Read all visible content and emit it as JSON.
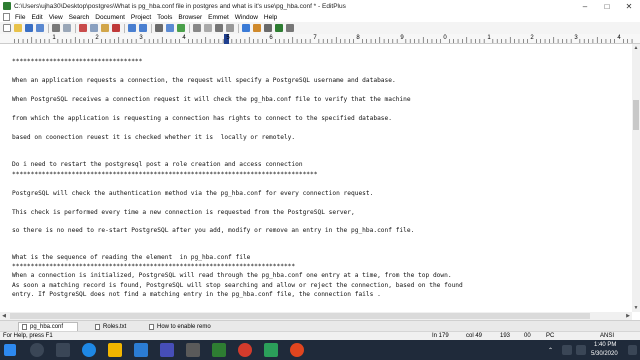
{
  "window": {
    "title": "C:\\Users\\ujha30\\Desktop\\postgres\\What is pg_hba.conf file in postgres and what is it's use\\pg_hba.conf * - EditPlus"
  },
  "menu": [
    "File",
    "Edit",
    "View",
    "Search",
    "Document",
    "Project",
    "Tools",
    "Browser",
    "Emmet",
    "Window",
    "Help"
  ],
  "ruler": [
    "1",
    "2",
    "3",
    "4",
    "5",
    "6",
    "7",
    "8",
    "9",
    "0",
    "1",
    "2",
    "3",
    "4"
  ],
  "editor": {
    "lines": [
      "***********************************",
      "",
      "When an application requests a connection, the request will specify a PostgreSQL username and database.",
      "",
      "When PostgreSQL receives a connection request it will check the pg_hba.conf file to verify that the machine",
      "",
      "from which the application is requesting a connection has rights to connect to the specified database.",
      "",
      "based on coonection reuest it is checked whether it is  locally or remotely.",
      "",
      "",
      "Do i need to restart the postgresql post a role creation and access connection",
      "**********************************************************************************",
      "",
      "PostgreSQL will check the authentication method via the pg_hba.conf for every connection request.",
      "",
      "This check is performed every time a new connection is requested from the PostgreSQL server,",
      "",
      "",
      "so there is no need to re-start PostgreSQL after you add, modify or remove an entry in the pg_hba.conf file.",
      "",
      "",
      "What is the sequence of reading the element  in pg_hba.conf file",
      "****************************************************************************",
      "When a connection is initialized, PostgreSQL will read through the pg_hba.conf one entry at a time, from the top down.",
      "As soon a matching record is found, PostgreSQL will stop searching and allow or reject the connection, based on the found",
      "entry. If PostgreSQL does not find a matching entry in the pg_hba.conf file, the connection fails ."
    ]
  },
  "tabs": [
    {
      "label": "pg_hba.conf",
      "active": true
    },
    {
      "label": "Roles.txt",
      "active": false
    },
    {
      "label": "How to enable remo",
      "active": false
    }
  ],
  "status": {
    "help": "For Help, press F1",
    "line": "In 179",
    "col": "col 49",
    "num1": "193",
    "num2": "00",
    "mode": "PC",
    "encoding": "ANSI"
  },
  "taskbar": {
    "time": "1:40 PM",
    "date": "5/30/2020"
  },
  "colors": {
    "taskbar": "#1f2a3a",
    "app_icon": "#2e7d32"
  }
}
